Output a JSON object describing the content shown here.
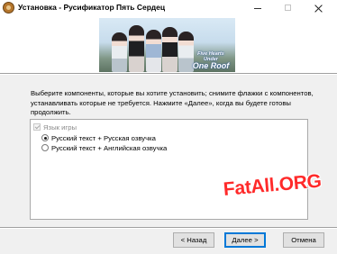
{
  "window": {
    "title": "Установка - Русификатор Пять Сердец",
    "app_icon": "installer-icon",
    "controls": [
      "minimize-icon",
      "maximize-icon",
      "close-icon"
    ]
  },
  "banner": {
    "logo_line1": "Five Hearts Under",
    "logo_line2": "One Roof",
    "accent": "#3c6bb0"
  },
  "instructions": "Выберите компоненты, которые вы хотите установить; снимите флажки с компонентов, устанавливать которые не требуется. Нажмите «Далее», когда вы будете готовы продолжить.",
  "components": {
    "group": {
      "label": "Язык игры",
      "checked": true,
      "disabled": true
    },
    "options": [
      {
        "label": "Русский текст + Русская озвучка",
        "selected": true
      },
      {
        "label": "Русский текст + Английская озвучка",
        "selected": false
      }
    ]
  },
  "watermark": {
    "text": "FatAll.ORG",
    "color": "#ff2a2a"
  },
  "buttons": {
    "back": "< Назад",
    "next": "Далее >",
    "cancel": "Отмена"
  }
}
